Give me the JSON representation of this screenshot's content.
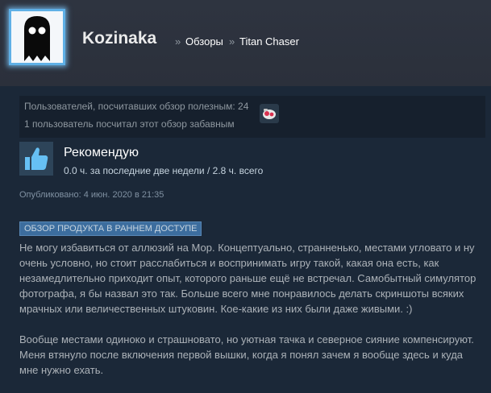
{
  "header": {
    "profile_name": "Kozinaka",
    "breadcrumb_sep": "»",
    "crumb_reviews": "Обзоры",
    "crumb_game": "Titan Chaser"
  },
  "votes": {
    "helpful": "Пользователей, посчитавших обзор полезным: 24",
    "funny": "1 пользователь посчитал этот обзор забавным"
  },
  "review": {
    "verdict": "Рекомендую",
    "hours": "0.0 ч. за последние две недели / 2.8 ч. всего",
    "posted": "Опубликовано: 4 июн. 2020 в 21:35",
    "badge": "ОБЗОР ПРОДУКТА В РАННЕМ ДОСТУПЕ",
    "paragraphs": [
      "Не могу избавиться от аллюзий на Мор. Концептуально, странненько, местами угловато и ну очень условно, но стоит расслабиться и воспринимать игру такой, какая она есть, как незамедлительно приходит опыт, которого раньше ещё не встречал. Самобытный симулятор фотографа, я бы назвал это так. Больше всего мне понравилось делать скриншоты всяких мрачных или величественных штуковин. Кое-какие из них были даже живыми. :)",
      "Вообще местами одиноко и страшновато, но уютная тачка и северное сияние компенсируют. Меня втянуло после включения первой вышки, когда я понял зачем я вообще здесь и куда мне нужно ехать."
    ]
  },
  "icons": {
    "avatar": "ghost-avatar",
    "award": "award-icon",
    "thumb": "thumbs-up-icon"
  },
  "colors": {
    "background": "#1b2838",
    "header": "#2e3440",
    "badge": "#3c6d9e",
    "thumb": "#66c0f4"
  }
}
